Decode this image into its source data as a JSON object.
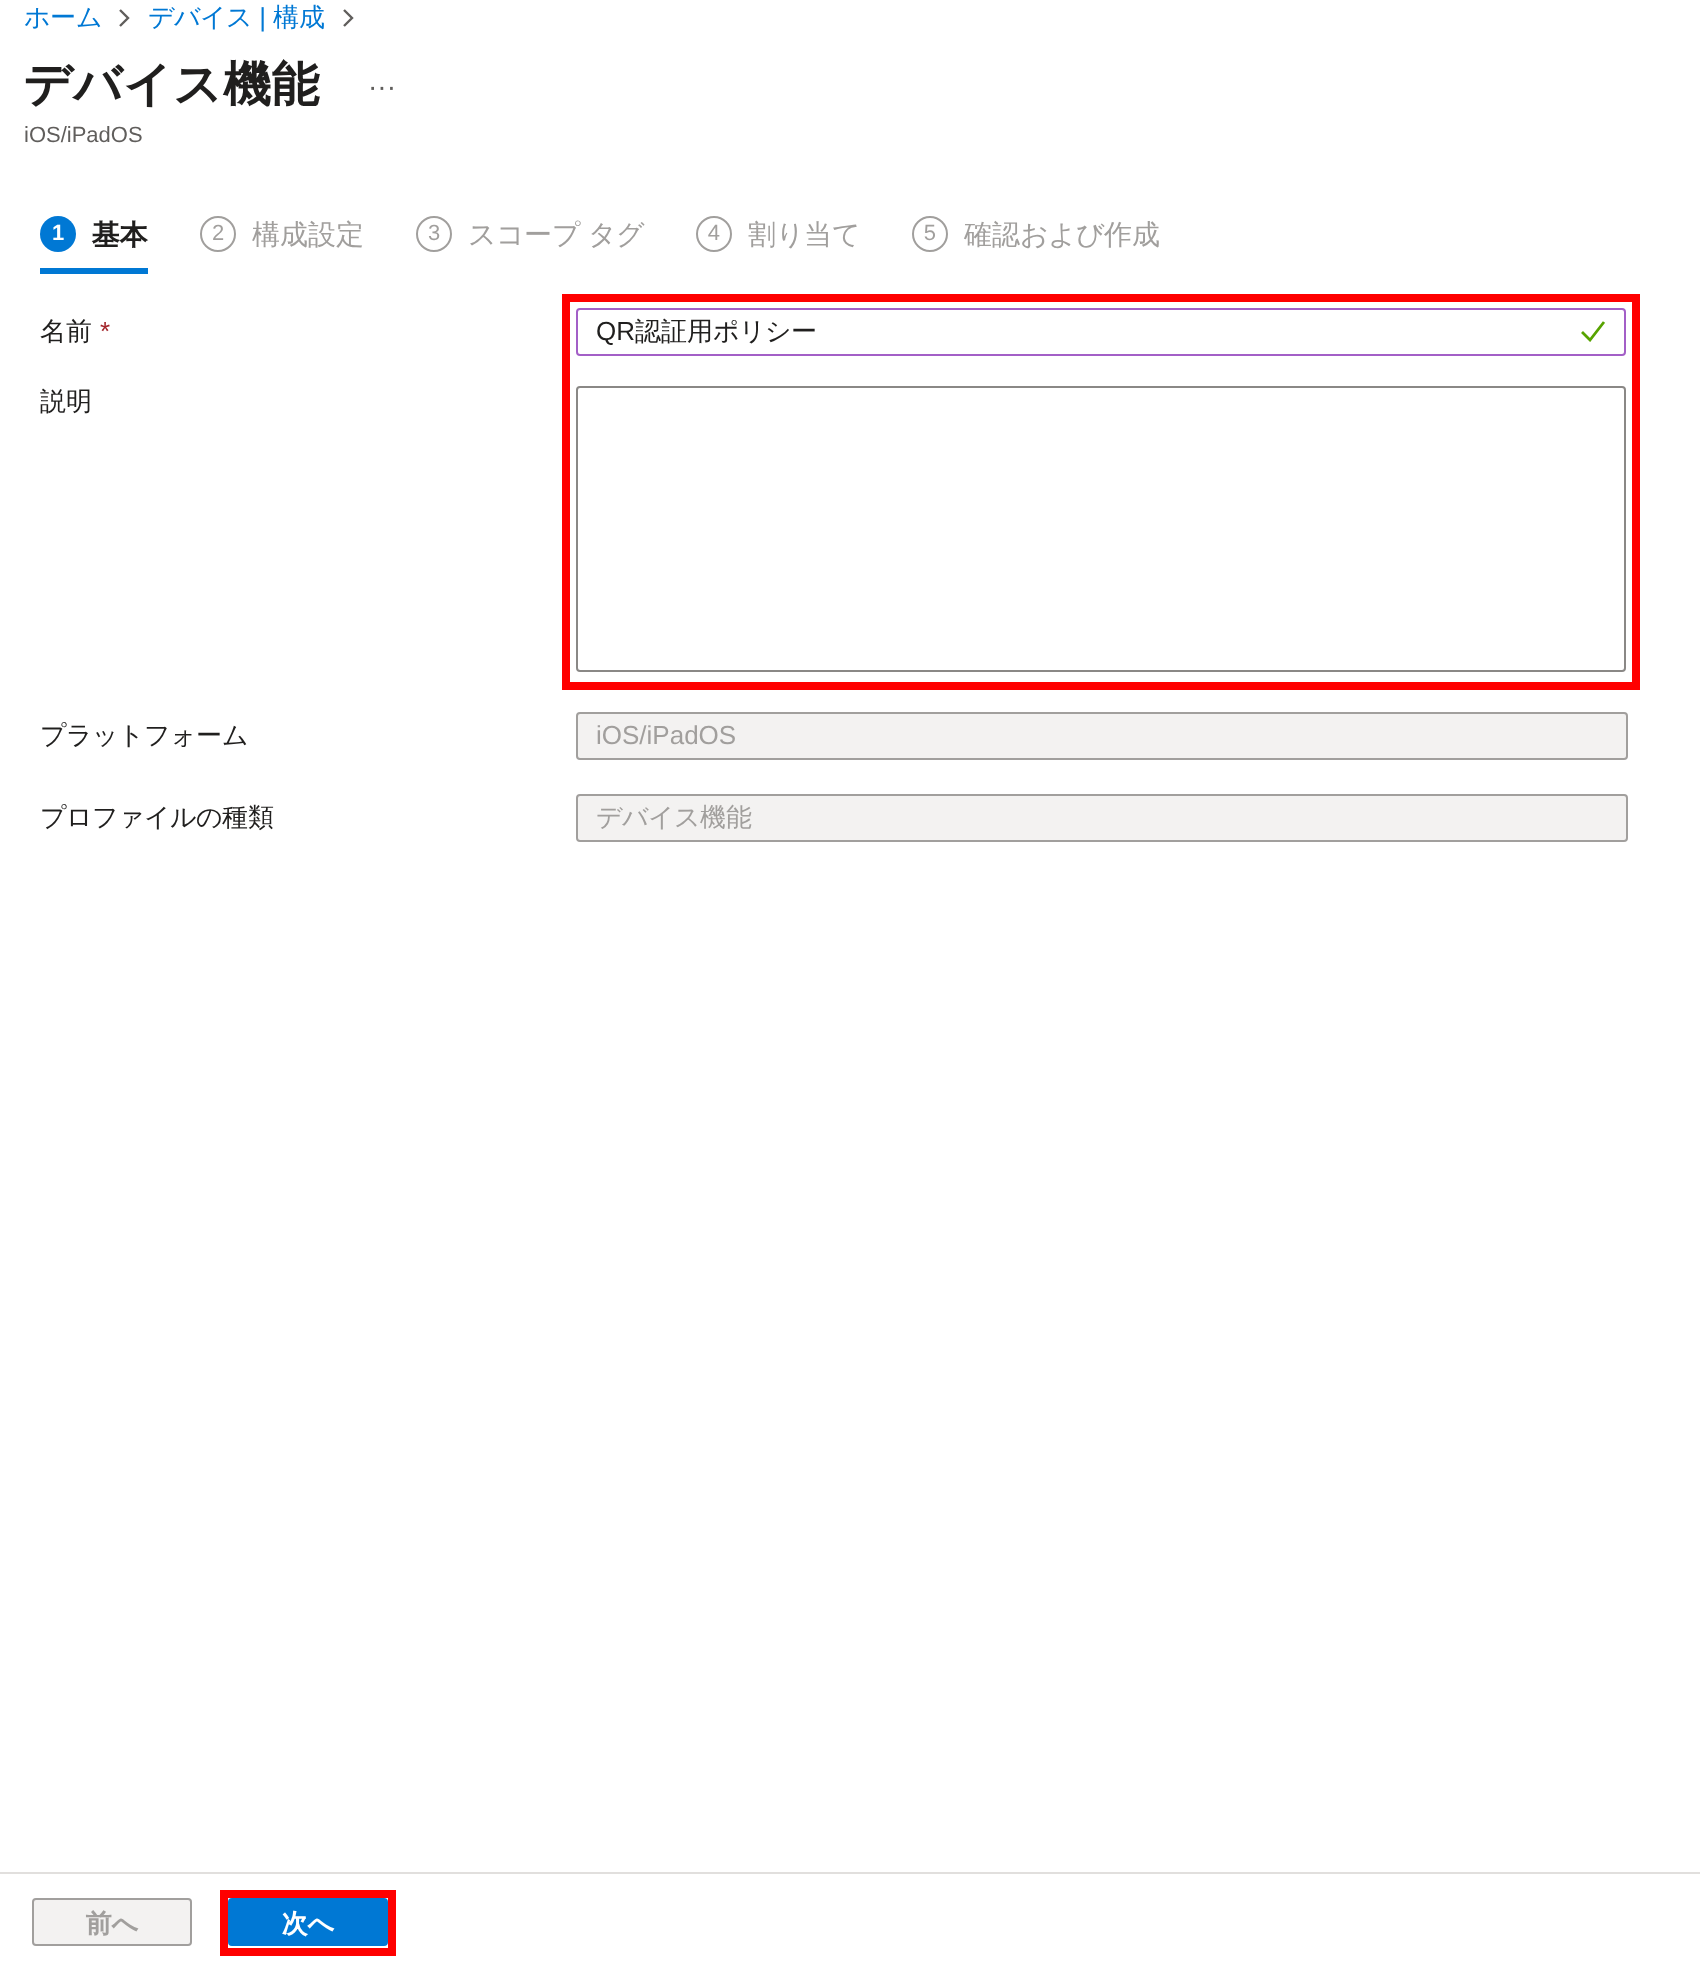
{
  "breadcrumb": [
    {
      "label": "ホーム"
    },
    {
      "label": "デバイス | 構成"
    }
  ],
  "title": "デバイス機能",
  "more": "···",
  "subtitle": "iOS/iPadOS",
  "steps": [
    {
      "number": "1",
      "label": "基本",
      "selected": true
    },
    {
      "number": "2",
      "label": "構成設定",
      "selected": false
    },
    {
      "number": "3",
      "label": "スコープ タグ",
      "selected": false
    },
    {
      "number": "4",
      "label": "割り当て",
      "selected": false
    },
    {
      "number": "5",
      "label": "確認および作成",
      "selected": false
    }
  ],
  "fields": [
    {
      "kind": "text",
      "label": "名前",
      "required_mark": "*",
      "value": "QR認証用ポリシー",
      "valid": true,
      "highlighted": true
    },
    {
      "kind": "textarea",
      "label": "説明",
      "highlighted": true
    },
    {
      "kind": "text",
      "label": "プラットフォーム",
      "value": "iOS/iPadOS",
      "disabled": true
    },
    {
      "kind": "text",
      "label": "プロファイルの種類",
      "value": "デバイス機能",
      "disabled": true
    }
  ],
  "buttons": [
    {
      "label": "前へ",
      "disabled": true,
      "primary": false,
      "highlighted": false
    },
    {
      "label": "次へ",
      "disabled": false,
      "primary": true,
      "highlighted": true
    }
  ]
}
